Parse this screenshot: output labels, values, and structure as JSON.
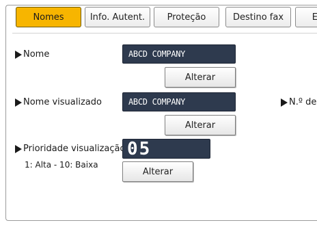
{
  "tabs": [
    {
      "label": "Nomes",
      "active": true
    },
    {
      "label": "Info. Autent.",
      "active": false
    },
    {
      "label": "Proteção",
      "active": false
    },
    {
      "label": "Destino fax",
      "active": false
    },
    {
      "label": "E",
      "active": false
    }
  ],
  "fields": {
    "name": {
      "label": "Nome",
      "value": "ABCD COMPANY",
      "button": "Alterar"
    },
    "display_name": {
      "label": "Nome visualizado",
      "value": "ABCD COMPANY",
      "button": "Alterar"
    },
    "registration_number": {
      "label": "N.º de"
    },
    "display_priority": {
      "label": "Prioridade visualização",
      "value": "05",
      "hint": "1: Alta - 10: Baixa",
      "button": "Alterar"
    }
  },
  "colors": {
    "active_tab": "#f7b500",
    "field_background": "#2e3a4e",
    "field_text": "#ffffff"
  }
}
